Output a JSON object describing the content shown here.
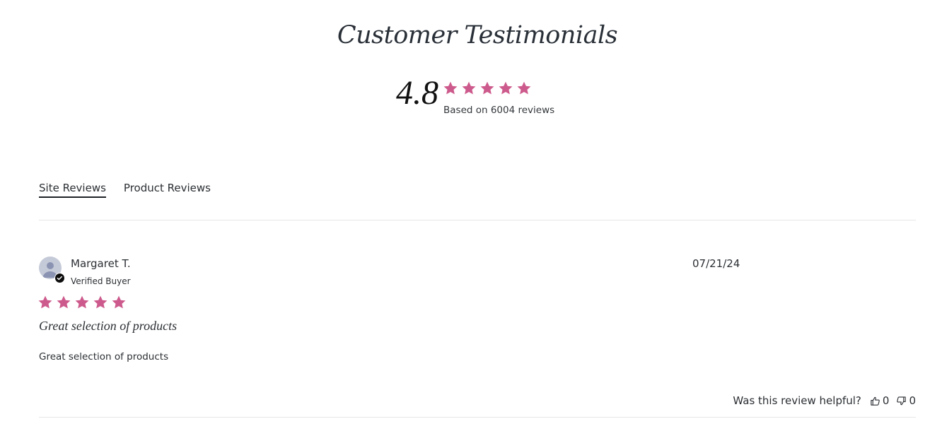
{
  "header": {
    "title": "Customer Testimonials"
  },
  "summary": {
    "average_rating": "4.8",
    "stars": 5,
    "star_color": "#cd5a8c",
    "based_on": "Based on 6004 reviews"
  },
  "tabs": [
    {
      "label": "Site Reviews",
      "active": true
    },
    {
      "label": "Product Reviews",
      "active": false
    }
  ],
  "review": {
    "author": "Margaret T.",
    "verified_label": "Verified Buyer",
    "date": "07/21/24",
    "rating": 5,
    "title": "Great selection of products",
    "body": "Great selection of products",
    "helpful_prompt": "Was this review helpful?",
    "upvotes": "0",
    "downvotes": "0"
  },
  "icons": {
    "star": "star-icon",
    "avatar": "user-icon",
    "verified": "check-icon",
    "thumbs_up": "thumbs-up-icon",
    "thumbs_down": "thumbs-down-icon"
  }
}
